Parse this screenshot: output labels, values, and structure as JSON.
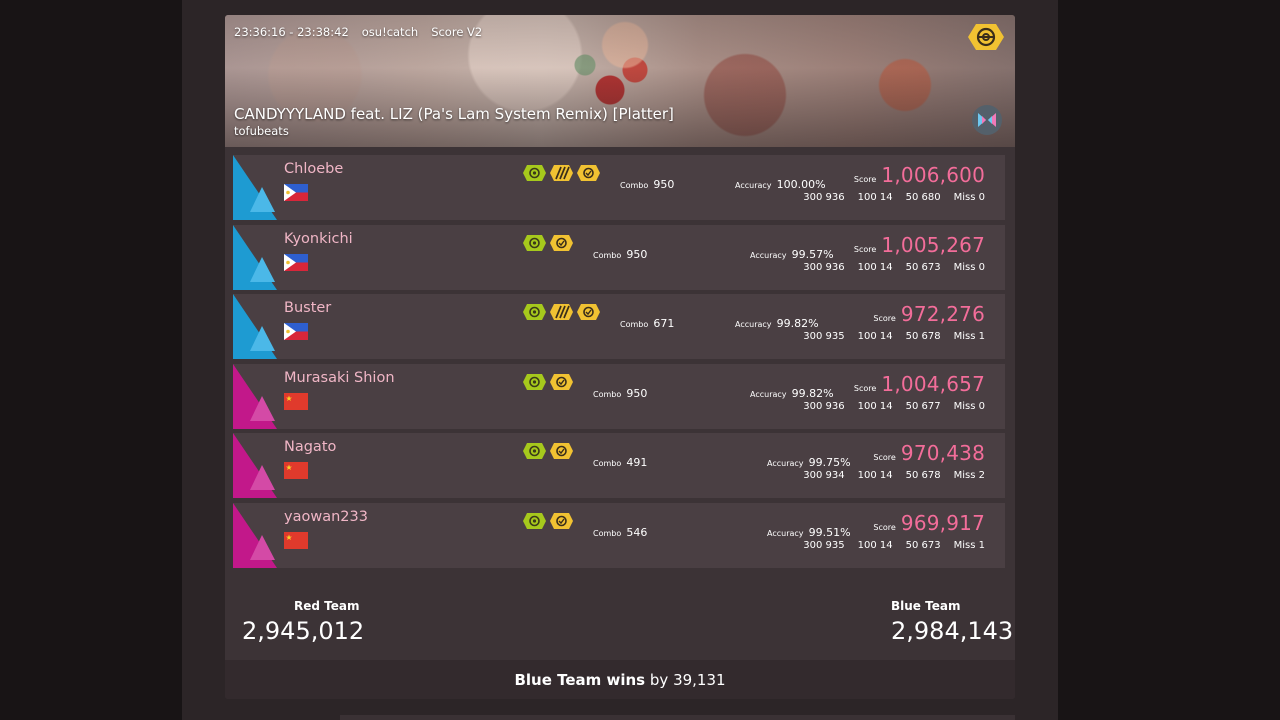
{
  "header": {
    "time": "23:36:16 - 23:38:42",
    "mode": "osu!catch",
    "scoring": "Score V2",
    "title": "CANDYYYLAND feat. LIZ (Pa's Lam System Remix) [Platter]",
    "artist": "tofubeats",
    "mode_icon": "osu-catch-mode-icon",
    "ruleset_icon": "bowtie-ruleset-icon"
  },
  "labels": {
    "combo": "Combo",
    "accuracy": "Accuracy",
    "score": "Score",
    "miss": "Miss"
  },
  "players": [
    {
      "name": "Chloebe",
      "team": "blue",
      "flag": "PH",
      "mods": [
        "hidden",
        "hard-rock",
        "nightcore"
      ],
      "combo": "950",
      "accuracy": "100.00%",
      "score": "1,006,600",
      "h300": "300 936",
      "h100": "100 14",
      "h50": "50 680",
      "miss": "0"
    },
    {
      "name": "Kyonkichi",
      "team": "blue",
      "flag": "PH",
      "mods": [
        "hidden",
        "nightcore"
      ],
      "combo": "950",
      "accuracy": "99.57%",
      "score": "1,005,267",
      "h300": "300 936",
      "h100": "100 14",
      "h50": "50 673",
      "miss": "0"
    },
    {
      "name": "Buster",
      "team": "blue",
      "flag": "PH",
      "mods": [
        "hidden",
        "hard-rock",
        "nightcore"
      ],
      "combo": "671",
      "accuracy": "99.82%",
      "score": "972,276",
      "h300": "300 935",
      "h100": "100 14",
      "h50": "50 678",
      "miss": "1"
    },
    {
      "name": "Murasaki Shion",
      "team": "red",
      "flag": "CN",
      "mods": [
        "hidden",
        "nightcore"
      ],
      "combo": "950",
      "accuracy": "99.82%",
      "score": "1,004,657",
      "h300": "300 936",
      "h100": "100 14",
      "h50": "50 677",
      "miss": "0"
    },
    {
      "name": "Nagato",
      "team": "red",
      "flag": "CN",
      "mods": [
        "hidden",
        "nightcore"
      ],
      "combo": "491",
      "accuracy": "99.75%",
      "score": "970,438",
      "h300": "300 934",
      "h100": "100 14",
      "h50": "50 678",
      "miss": "2"
    },
    {
      "name": "yaowan233",
      "team": "red",
      "flag": "CN",
      "mods": [
        "hidden",
        "nightcore"
      ],
      "combo": "546",
      "accuracy": "99.51%",
      "score": "969,917",
      "h300": "300 935",
      "h100": "100 14",
      "h50": "50 673",
      "miss": "1"
    }
  ],
  "teams": {
    "red": {
      "label": "Red Team",
      "score": "2,945,012"
    },
    "blue": {
      "label": "Blue Team",
      "score": "2,984,143"
    }
  },
  "result": {
    "winner": "Blue Team wins",
    "by": "by",
    "margin": "39,131"
  },
  "colors": {
    "red_team": "#c2188a",
    "blue_team": "#1e9bd2",
    "score": "#f36d9a",
    "name": "#f0b6c6",
    "mod_green": "#a6c91c",
    "mod_yellow": "#f1c232"
  }
}
